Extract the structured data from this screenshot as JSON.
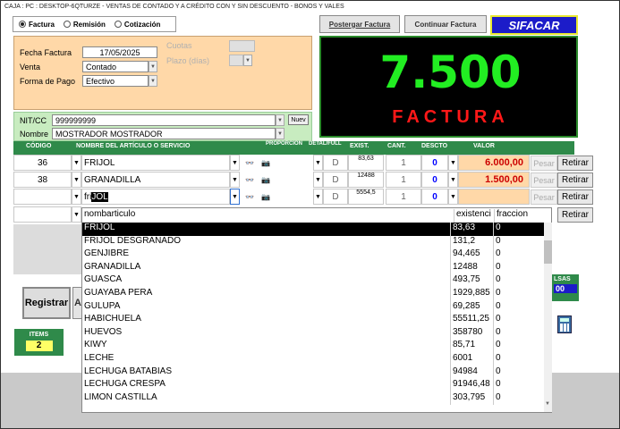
{
  "title": "CAJA : PC : DESKTOP-6QTURZE - VENTAS DE CONTADO Y A CRÉDITO CON Y SIN DESCUENTO - BONOS Y VALES",
  "doc_types": [
    "Factura",
    "Remisión",
    "Cotización"
  ],
  "buttons": {
    "postergar": "Postergar Factura",
    "continuar": "Continuar Factura",
    "sifacar": "SIFACAR",
    "nuev": "Nuev",
    "registrar": "Registrar",
    "a": "A"
  },
  "form": {
    "fecha_label": "Fecha Factura",
    "fecha": "17/05/2025",
    "venta_label": "Venta",
    "venta": "Contado",
    "pago_label": "Forma de Pago",
    "pago": "Efectivo",
    "cuotas_label": "Cuotas",
    "plazo_label": "Plazo (días)",
    "nit_label": "NIT/CC",
    "nit": "999999999",
    "nombre_label": "Nombre",
    "nombre": "MOSTRADOR MOSTRADOR"
  },
  "display": {
    "total": "7.500",
    "doc_word": "FACTURA"
  },
  "headers": {
    "codigo": "CÓDIGO",
    "nombre": "NOMBRE DEL ARTÍCULO O SERVICIO",
    "proporcion": "PROPORCION",
    "detal": "DETAL/FULL",
    "exist": "EXIST.",
    "cant": "CANT.",
    "descto": "DESCTO",
    "valor": "VALOR"
  },
  "rows": [
    {
      "codigo": "36",
      "nombre": "FRIJOL",
      "df": "D",
      "exist": "83,63",
      "cant": "1",
      "descto": "0",
      "valor": "6.000,00",
      "pesar": "Pesar",
      "retirar": "Retirar"
    },
    {
      "codigo": "38",
      "nombre": "GRANADILLA",
      "df": "D",
      "exist": "12488",
      "cant": "1",
      "descto": "0",
      "valor": "1.500,00",
      "pesar": "Pesar",
      "retirar": "Retirar"
    },
    {
      "codigo": "",
      "nombre_typed": "fri",
      "nombre_sel": "JOL",
      "df": "D",
      "exist": "5554,5",
      "cant": "1",
      "descto": "0",
      "valor": "",
      "pesar": "Pesar",
      "retirar": "Retirar"
    },
    {
      "retirar": "Retirar"
    }
  ],
  "dropdown": {
    "headers": [
      "nombarticulo",
      "existenci",
      "fraccion"
    ],
    "items": [
      [
        "FRIJOL",
        "83,63",
        "0"
      ],
      [
        "FRIJOL DESGRANADO",
        "131,2",
        "0"
      ],
      [
        "GENJIBRE",
        "94,465",
        "0"
      ],
      [
        "GRANADILLA",
        "12488",
        "0"
      ],
      [
        "GUASCA",
        "493,75",
        "0"
      ],
      [
        "GUAYABA PERA",
        "1929,885",
        "0"
      ],
      [
        "GULUPA",
        "69,285",
        "0"
      ],
      [
        "HABICHUELA",
        "55511,25",
        "0"
      ],
      [
        "HUEVOS",
        "358780",
        "0"
      ],
      [
        "KIWY",
        "85,71",
        "0"
      ],
      [
        "LECHE",
        "6001",
        "0"
      ],
      [
        "LECHUGA BATABIAS",
        "94984",
        "0"
      ],
      [
        "LECHUGA CRESPA",
        "91946,48",
        "0"
      ],
      [
        "LIMON CASTILLA",
        "303,795",
        "0"
      ]
    ]
  },
  "bottom": {
    "items_label": "ITEMS",
    "items": "2",
    "bolsas_label": "LSAS",
    "bolsas": "00"
  },
  "colors": {
    "green_header": "#2f8a4a",
    "display_bg": "#000000",
    "total_color": "#22ee22",
    "word_color": "#ff1818",
    "orange": "#ffd8a8"
  }
}
